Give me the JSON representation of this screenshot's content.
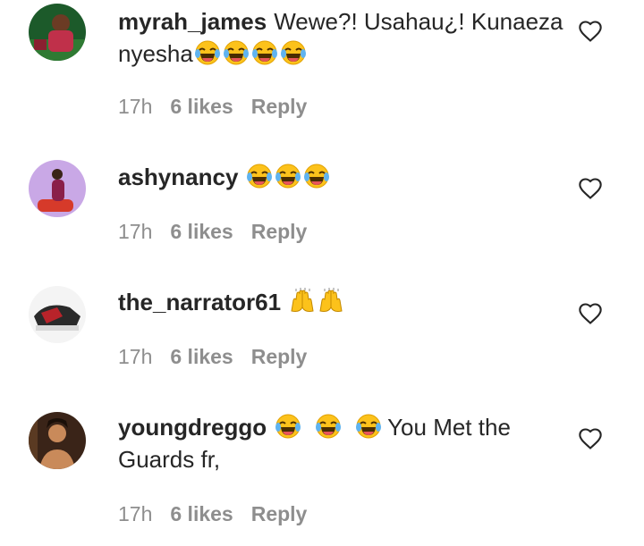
{
  "comments": [
    {
      "username": "myrah_james",
      "text": "Wewe?! Usahau¿! Kunaeza nyesha",
      "emojis": [
        "face-with-tears-of-joy",
        "face-with-tears-of-joy",
        "face-with-tears-of-joy",
        "face-with-tears-of-joy"
      ],
      "time": "17h",
      "likes": "6 likes",
      "reply": "Reply",
      "avatar_colors": [
        "#1c5a2a",
        "#c0304a"
      ]
    },
    {
      "username": "ashynancy",
      "text": "",
      "emojis": [
        "face-with-tears-of-joy",
        "face-with-tears-of-joy",
        "face-with-tears-of-joy"
      ],
      "time": "17h",
      "likes": "6 likes",
      "reply": "Reply",
      "avatar_colors": [
        "#c9a8e6",
        "#d63a2a"
      ]
    },
    {
      "username": "the_narrator61",
      "text": "",
      "emojis": [
        "raising-hands",
        "raising-hands"
      ],
      "time": "17h",
      "likes": "6 likes",
      "reply": "Reply",
      "avatar_colors": [
        "#2a2a2a",
        "#b8232a"
      ]
    },
    {
      "username": "youngdreggo",
      "text": "You Met the Guards fr,",
      "emojis": [
        "face-with-tears-of-joy",
        "face-with-tears-of-joy",
        "face-with-tears-of-joy"
      ],
      "time": "17h",
      "likes": "6 likes",
      "reply": "Reply",
      "avatar_colors": [
        "#3a2418",
        "#c98a5a"
      ]
    }
  ],
  "icons": {
    "like": "heart-outline-icon"
  }
}
